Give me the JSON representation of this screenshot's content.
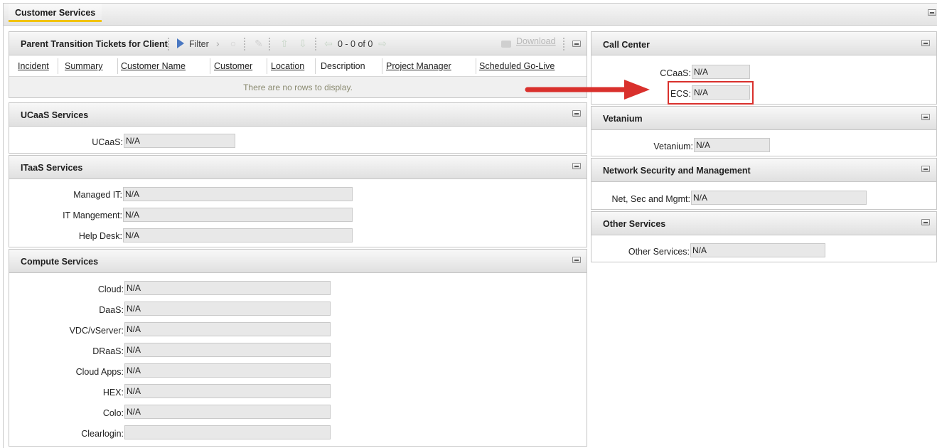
{
  "page": {
    "tab_label": "Customer Services"
  },
  "tickets": {
    "title": "Parent Transition Tickets for Client",
    "filter_label": "Filter",
    "pagination": "0 - 0 of 0",
    "download_label": "Download",
    "columns": [
      "Incident",
      "Summary",
      "Customer Name",
      "Customer",
      "Location",
      "Description",
      "Project Manager",
      "Scheduled Go-Live"
    ],
    "empty_message": "There are no rows to display."
  },
  "ucaas": {
    "title": "UCaaS Services",
    "fields": [
      {
        "label": "UCaaS:",
        "value": "N/A"
      }
    ]
  },
  "itaas": {
    "title": "ITaaS Services",
    "fields": [
      {
        "label": "Managed IT:",
        "value": "N/A"
      },
      {
        "label": "IT Mangement:",
        "value": "N/A"
      },
      {
        "label": "Help Desk:",
        "value": "N/A"
      }
    ]
  },
  "compute": {
    "title": "Compute Services",
    "fields": [
      {
        "label": "Cloud:",
        "value": "N/A"
      },
      {
        "label": "DaaS:",
        "value": "N/A"
      },
      {
        "label": "VDC/vServer:",
        "value": "N/A"
      },
      {
        "label": "DRaaS:",
        "value": "N/A"
      },
      {
        "label": "Cloud Apps:",
        "value": "N/A"
      },
      {
        "label": "HEX:",
        "value": "N/A"
      },
      {
        "label": "Colo:",
        "value": "N/A"
      },
      {
        "label": "Clearlogin:",
        "value": ""
      }
    ]
  },
  "call_center": {
    "title": "Call Center",
    "fields": [
      {
        "label": "CCaaS:",
        "value": "N/A"
      },
      {
        "label": "ECS:",
        "value": "N/A"
      }
    ]
  },
  "vetanium": {
    "title": "Vetanium",
    "fields": [
      {
        "label": "Vetanium:",
        "value": "N/A"
      }
    ]
  },
  "netsec": {
    "title": "Network Security and Management",
    "fields": [
      {
        "label": "Net, Sec and Mgmt:",
        "value": "N/A"
      }
    ]
  },
  "other": {
    "title": "Other Services",
    "fields": [
      {
        "label": "Other Services:",
        "value": "N/A"
      }
    ]
  },
  "colors": {
    "highlight": "#d9302c",
    "tab_underline": "#f2c300",
    "filter_arrow": "#4a78c2"
  }
}
